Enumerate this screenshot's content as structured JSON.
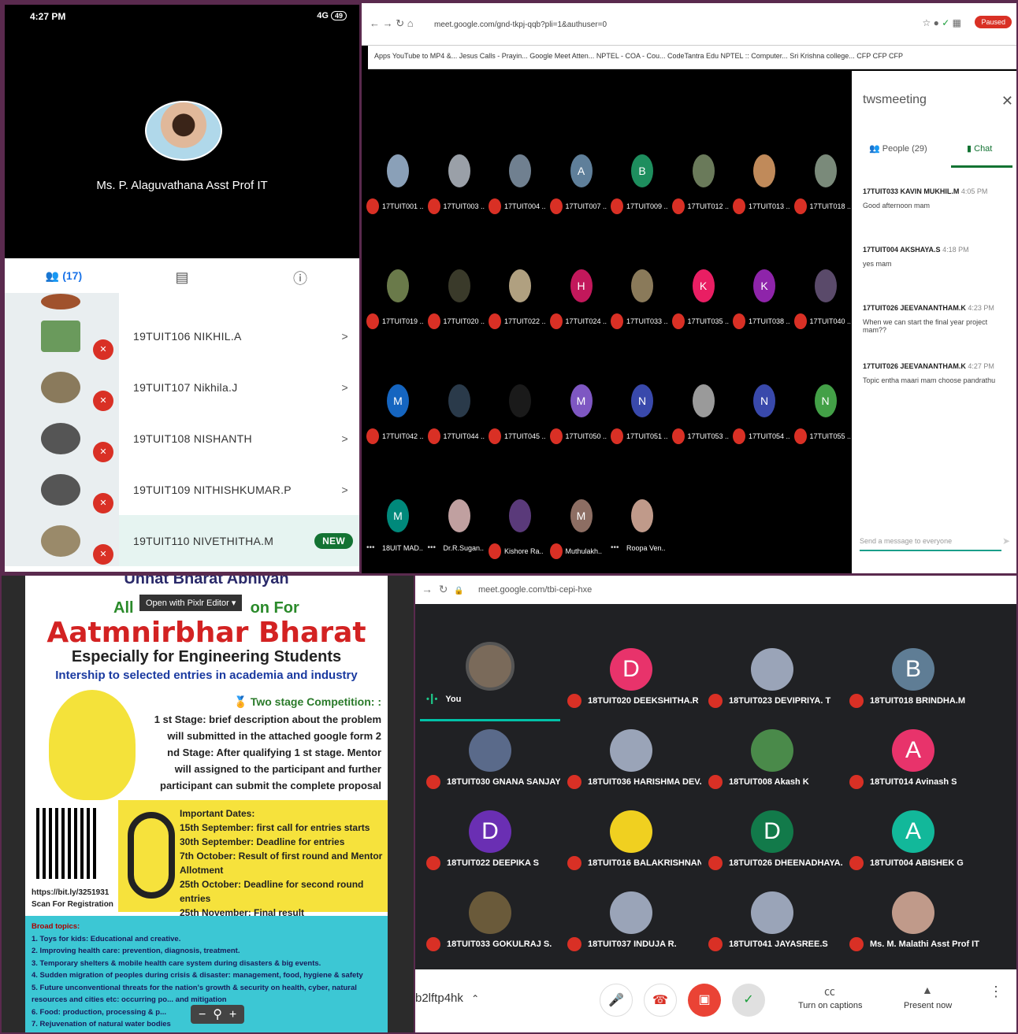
{
  "phone": {
    "time": "4:27 PM",
    "status": "4G",
    "battery": "49",
    "host": "Ms. P. Alaguvathana Asst Prof IT",
    "people_count": "(17)",
    "rows": [
      {
        "name": "19TUIT106 NIKHIL.A",
        "new": ""
      },
      {
        "name": "19TUIT107 Nikhila.J",
        "new": ""
      },
      {
        "name": "19TUIT108 NISHANTH",
        "new": ""
      },
      {
        "name": "19TUIT109 NITHISHKUMAR.P",
        "new": ""
      },
      {
        "name": "19TUIT110 NIVETHITHA.M",
        "new": "NEW"
      }
    ]
  },
  "meet1": {
    "url": "meet.google.com/gnd-tkpj-qqb?pli=1&authuser=0",
    "paused": "Paused",
    "bookmarks": "Apps   YouTube to MP4 &...   Jesus Calls - Prayin...   Google Meet Atten...   NPTEL - COA - Cou...   CodeTantra Edu   NPTEL :: Computer...   Sri Krishna college...   CFP   CFP   CFP",
    "tiles": [
      {
        "l": "17TUIT001 ..",
        "a": "",
        "c": "#8aa0b8"
      },
      {
        "l": "17TUIT003 ..",
        "a": "",
        "c": "#9aa0a8"
      },
      {
        "l": "17TUIT004 ..",
        "a": "",
        "c": "#708090"
      },
      {
        "l": "17TUIT007 ..",
        "a": "A",
        "c": "#5f7f9a"
      },
      {
        "l": "17TUIT009 ..",
        "a": "B",
        "c": "#1e8e5e"
      },
      {
        "l": "17TUIT012 ..",
        "a": "",
        "c": "#6a7a5a"
      },
      {
        "l": "17TUIT013 ..",
        "a": "",
        "c": "#c08a5a"
      },
      {
        "l": "17TUIT018 ..",
        "a": "",
        "c": "#7a8a7a"
      },
      {
        "l": "17TUIT019 ..",
        "a": "",
        "c": "#6a7a4a"
      },
      {
        "l": "17TUIT020 ..",
        "a": "",
        "c": "#3a3a2a"
      },
      {
        "l": "17TUIT022 ..",
        "a": "",
        "c": "#b0a080"
      },
      {
        "l": "17TUIT024 ..",
        "a": "H",
        "c": "#c2185b"
      },
      {
        "l": "17TUIT033 ..",
        "a": "",
        "c": "#8a7a5a"
      },
      {
        "l": "17TUIT035 ..",
        "a": "K",
        "c": "#e91e63"
      },
      {
        "l": "17TUIT038 ..",
        "a": "K",
        "c": "#8e24aa"
      },
      {
        "l": "17TUIT040 ..",
        "a": "",
        "c": "#5a4a6a"
      },
      {
        "l": "17TUIT042 ..",
        "a": "M",
        "c": "#1565c0"
      },
      {
        "l": "17TUIT044 ..",
        "a": "",
        "c": "#2a3a4a"
      },
      {
        "l": "17TUIT045 ..",
        "a": "",
        "c": "#1a1a1a"
      },
      {
        "l": "17TUIT050 ..",
        "a": "M",
        "c": "#7e57c2"
      },
      {
        "l": "17TUIT051 ..",
        "a": "N",
        "c": "#3949ab"
      },
      {
        "l": "17TUIT053 ..",
        "a": "",
        "c": "#9a9a9a"
      },
      {
        "l": "17TUIT054 ..",
        "a": "N",
        "c": "#3949ab"
      },
      {
        "l": "17TUIT055 ..",
        "a": "N",
        "c": "#43a047"
      },
      {
        "l": "18UIT MAD..",
        "a": "M",
        "c": "#00897b"
      },
      {
        "l": "Dr.R.Sugan..",
        "a": "",
        "c": "#c0a0a0"
      },
      {
        "l": "Kishore Ra..",
        "a": "",
        "c": "#5a3a7a"
      },
      {
        "l": "Muthulakh..",
        "a": "M",
        "c": "#8d6e63"
      },
      {
        "l": "Roopa Ven..",
        "a": "",
        "c": "#c09a8a"
      }
    ],
    "dots_on": [
      24,
      25,
      28
    ],
    "panel_title": "twsmeeting",
    "people_tab": "People (29)",
    "chat_tab": "Chat",
    "messages": [
      {
        "from": "17TUIT033 KAVIN MUKHIL.M",
        "time": "4:05 PM",
        "text": "Good afternoon mam"
      },
      {
        "from": "17TUIT004 AKSHAYA.S",
        "time": "4:18 PM",
        "text": "yes mam"
      },
      {
        "from": "17TUIT026 JEEVANANTHAM.K",
        "time": "4:23 PM",
        "text": "When we can start the final year project mam??"
      },
      {
        "from": "17TUIT026 JEEVANANTHAM.K",
        "time": "4:27 PM",
        "text": "Topic entha maari mam choose pandrathu"
      }
    ],
    "send_placeholder": "Send a message to everyone"
  },
  "poster": {
    "head": "Unnat Bharat Abhiyan",
    "all": "All",
    "pixlr": "Open with Pixlr Editor",
    "competition": "on For",
    "title": "Aatmnirbhar Bharat",
    "subtitle": "Especially for Engineering  Students",
    "intern": "Intership to selected  entries in academia and industry",
    "two_stage": "Two stage Competition: :",
    "stages": "1 st Stage: brief description about the problem will submitted in the attached google form 2 nd Stage: After qualifying 1 st stage. Mentor will assigned to the participant and further participant can submit the complete proposal",
    "link": "https://bit.ly/3251931",
    "scan": "Scan For Registration",
    "dates_title": "Important Dates:",
    "dates": [
      "15th September: first call for entries starts",
      "30th September: Deadline for entries",
      "7th October: Result of first round and Mentor Allotment",
      "25th October: Deadline for second round entries",
      "25th November: Final result"
    ],
    "topics_title": "Broad topics:",
    "topics": [
      "1.   Toys for kids: Educational and creative.",
      "2.   Improving health care: prevention, diagnosis, treatment.",
      "3.   Temporary shelters & mobile health care system during disasters & big events.",
      "4.   Sudden migration of peoples during crisis & disaster: management, food, hygiene & safety",
      "5.   Future unconventional threats for the nation's growth & security on health, cyber, natural resources and cities etc: occurring po... and mitigation",
      "6.   Food: production, processing & p...",
      "7.   Rejuvenation of natural water bodies"
    ]
  },
  "meet2": {
    "url": "meet.google.com/tbi-cepi-hxe",
    "code": "b2lftp4hk",
    "you": "You",
    "cells": [
      {
        "l": "You",
        "a": "",
        "c": "#7a6a5a"
      },
      {
        "l": "18TUIT020 DEEKSHITHA.R",
        "a": "D",
        "c": "#e8336b"
      },
      {
        "l": "18TUIT023 DEVIPRIYA. T",
        "a": "",
        "c": "#9aa4b8"
      },
      {
        "l": "18TUIT018 BRINDHA.M",
        "a": "B",
        "c": "#5f7d95"
      },
      {
        "l": "18TUIT030 GNANA SANJAY...",
        "a": "",
        "c": "#5a6a8a"
      },
      {
        "l": "18TUIT036 HARISHMA DEV...",
        "a": "",
        "c": "#9aa4b8"
      },
      {
        "l": "18TUIT008 Akash K",
        "a": "",
        "c": "#4a8a4a"
      },
      {
        "l": "18TUIT014 Avinash S",
        "a": "A",
        "c": "#e8336b"
      },
      {
        "l": "18TUIT022 DEEPIKA S",
        "a": "D",
        "c": "#6a2fb3"
      },
      {
        "l": "18TUIT016 BALAKRISHNAN...",
        "a": "",
        "c": "#f0d020"
      },
      {
        "l": "18TUIT026 DHEENADHAYA...",
        "a": "D",
        "c": "#127a4a"
      },
      {
        "l": "18TUIT004 ABISHEK G",
        "a": "A",
        "c": "#12b89a"
      },
      {
        "l": "18TUIT033 GOKULRAJ S.",
        "a": "",
        "c": "#6a5a3a"
      },
      {
        "l": "18TUIT037 INDUJA R.",
        "a": "",
        "c": "#9aa4b8"
      },
      {
        "l": "18TUIT041 JAYASREE.S",
        "a": "",
        "c": "#9aa4b8"
      },
      {
        "l": "Ms. M. Malathi Asst Prof IT",
        "a": "",
        "c": "#c09a8a"
      }
    ],
    "captions": "Turn on captions",
    "present": "Present now"
  }
}
